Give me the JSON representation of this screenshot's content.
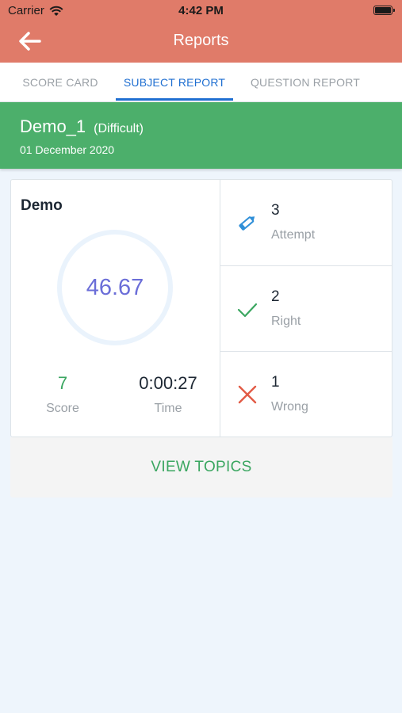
{
  "status_bar": {
    "carrier": "Carrier",
    "time": "4:42 PM",
    "wifi_icon": "wifi-icon",
    "battery_icon": "battery-icon"
  },
  "nav": {
    "title": "Reports",
    "back_icon": "arrow-left-icon"
  },
  "tabs": [
    {
      "label": "SCORE CARD",
      "active": false
    },
    {
      "label": "SUBJECT REPORT",
      "active": true
    },
    {
      "label": "QUESTION REPORT",
      "active": false
    }
  ],
  "test": {
    "name": "Demo_1",
    "difficulty": "(Difficult)",
    "date": "01 December 2020"
  },
  "report": {
    "subject": "Demo",
    "percentage": "46.67",
    "score_value": "7",
    "score_label": "Score",
    "time_value": "0:00:27",
    "time_label": "Time",
    "metrics": [
      {
        "value": "3",
        "label": "Attempt",
        "icon": "pencil-icon"
      },
      {
        "value": "2",
        "label": "Right",
        "icon": "checkmark-icon"
      },
      {
        "value": "1",
        "label": "Wrong",
        "icon": "cross-icon"
      }
    ]
  },
  "actions": {
    "view_topics": "VIEW TOPICS"
  },
  "colors": {
    "header": "#e07b69",
    "banner": "#4caf6b",
    "active_tab": "#1f6fd1",
    "percentage": "#6b6ed8",
    "accent_green": "#3aa660",
    "wrong_red": "#e25a45",
    "page_background": "#eef5fc"
  }
}
